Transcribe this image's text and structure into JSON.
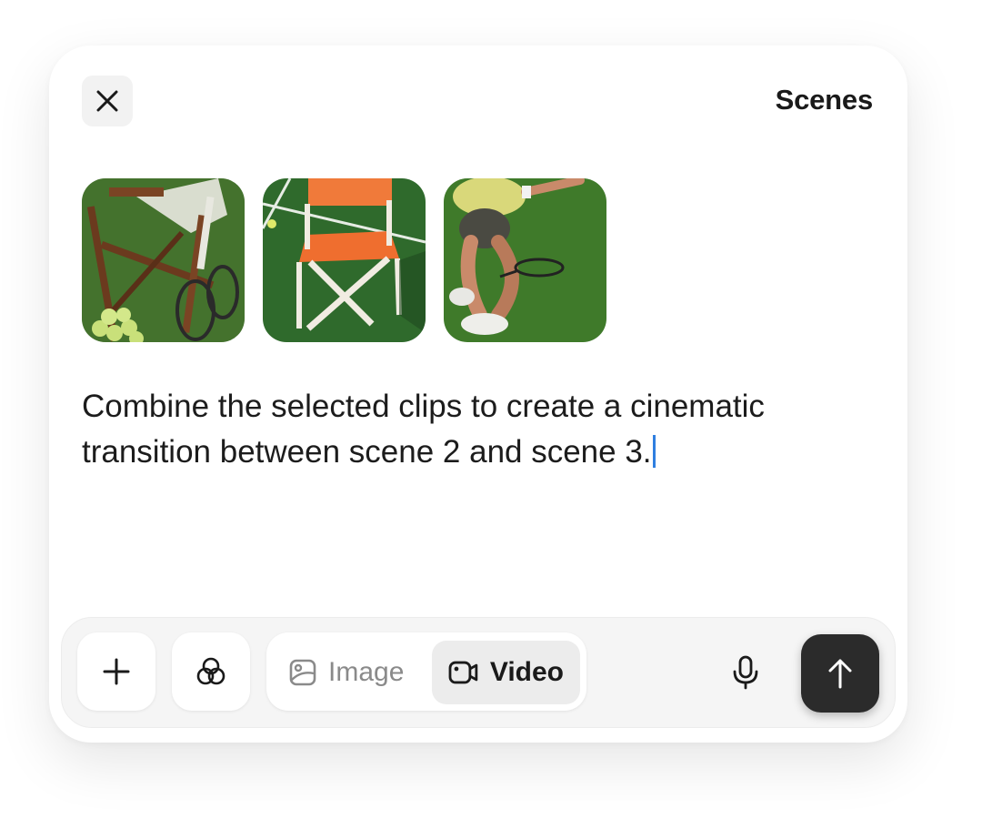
{
  "header": {
    "title": "Scenes",
    "close_icon": "close-icon"
  },
  "thumbnails": [
    {
      "name": "scene-thumbnail-1",
      "subject": "folding chair with tennis rackets and balls"
    },
    {
      "name": "scene-thumbnail-2",
      "subject": "orange director chair on tennis court"
    },
    {
      "name": "scene-thumbnail-3",
      "subject": "tennis player in motion"
    }
  ],
  "prompt": {
    "text": "Combine the selected clips to create a cinematic transition between scene 2 and scene 3."
  },
  "toolbar": {
    "add_icon": "plus-icon",
    "styles_icon": "overlapping-circles-icon",
    "modes": [
      {
        "label": "Image",
        "icon": "image-icon",
        "selected": false
      },
      {
        "label": "Video",
        "icon": "video-camera-icon",
        "selected": true
      }
    ],
    "mic_icon": "microphone-icon",
    "send_icon": "arrow-up-icon"
  },
  "colors": {
    "accent_caret": "#2f7fe0",
    "send_button": "#2b2b2b",
    "toolbar_bg": "#f5f5f5"
  }
}
